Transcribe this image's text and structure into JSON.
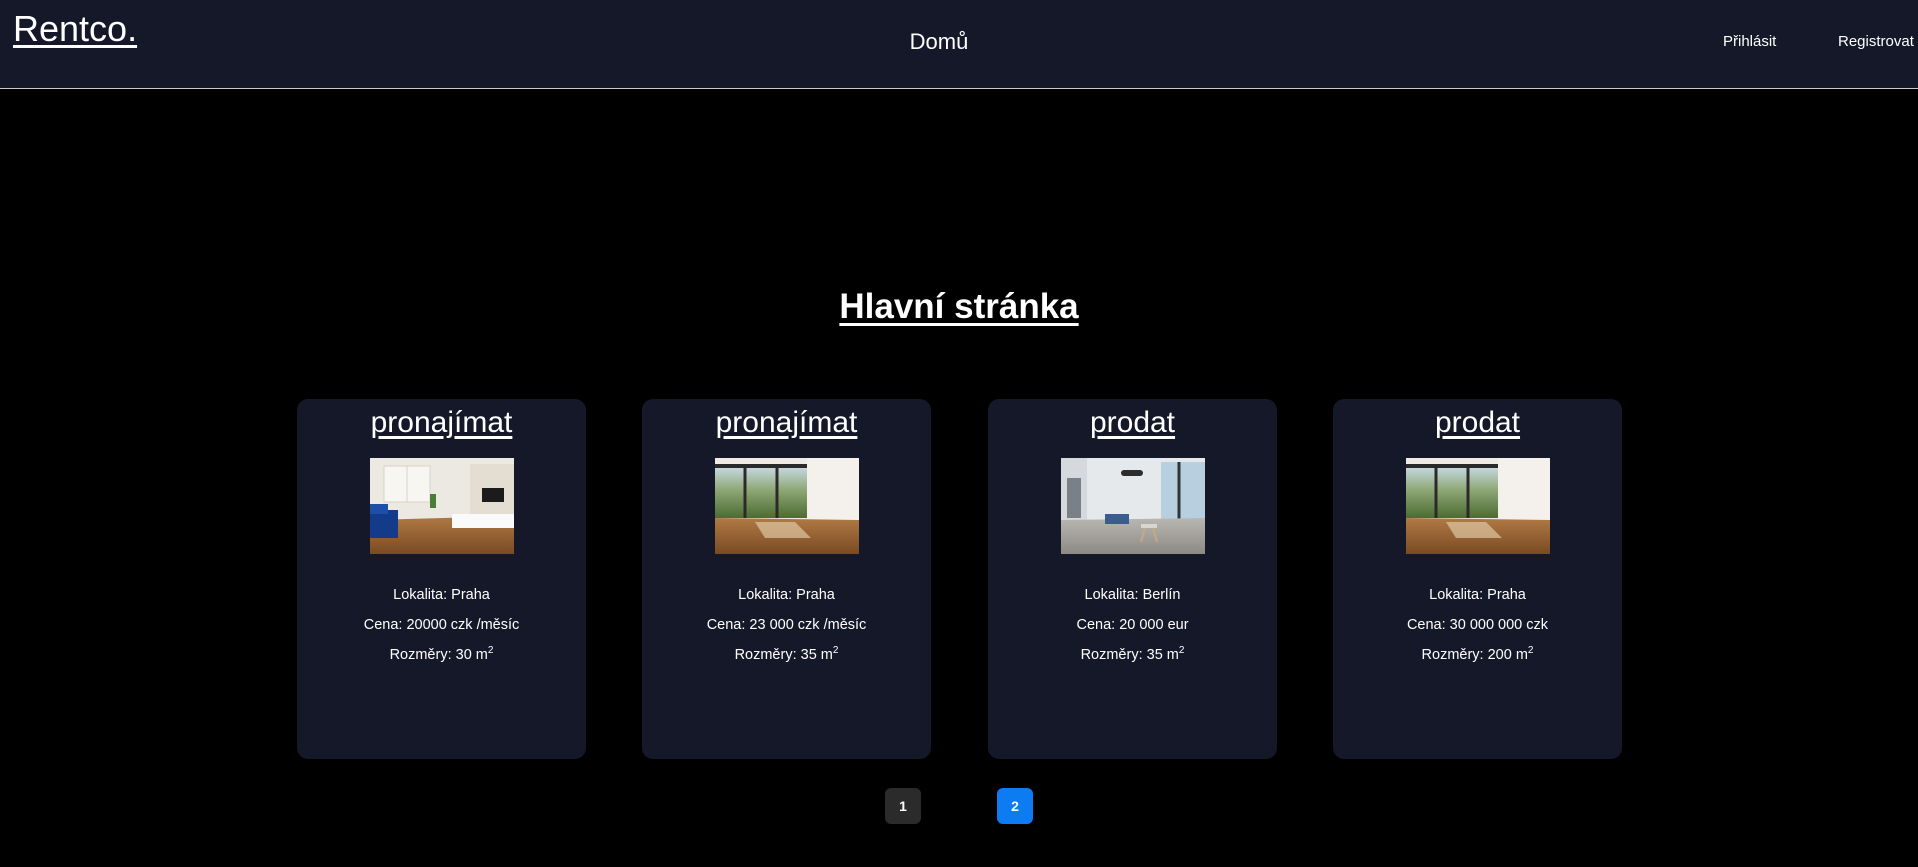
{
  "navbar": {
    "logo": "Rentco.",
    "center_link": "Domů",
    "login": "Přihlásit",
    "register": "Registrovat"
  },
  "main": {
    "title": "Hlavní stránka"
  },
  "listings": [
    {
      "type": "pronajímat",
      "image": "living-room-blue-sofa-photo",
      "location": "Lokalita: Praha",
      "price": "Cena: 20000 czk /měsíc",
      "size_prefix": "Rozměry: 30 m",
      "size_sup": "2"
    },
    {
      "type": "pronajímat",
      "image": "empty-room-panoramic-windows-photo",
      "location": "Lokalita: Praha",
      "price": "Cena: 23 000 czk /měsíc",
      "size_prefix": "Rozměry: 35 m",
      "size_sup": "2"
    },
    {
      "type": "prodat",
      "image": "bright-living-room-balcony-photo",
      "location": "Lokalita: Berlín",
      "price": "Cena: 20 000 eur",
      "size_prefix": "Rozměry: 35 m",
      "size_sup": "2"
    },
    {
      "type": "prodat",
      "image": "empty-room-panoramic-windows-photo",
      "location": "Lokalita: Praha",
      "price": "Cena: 30 000 000 czk",
      "size_prefix": "Rozměry: 200 m",
      "size_sup": "2"
    }
  ],
  "pagination": {
    "pages": [
      "1",
      "2"
    ],
    "active": "2"
  },
  "colors": {
    "navbar_bg": "#141829",
    "page_bg": "#000000",
    "card_bg": "#141829",
    "active_page": "#0d7cf2",
    "inactive_page": "#2b2b2b"
  }
}
